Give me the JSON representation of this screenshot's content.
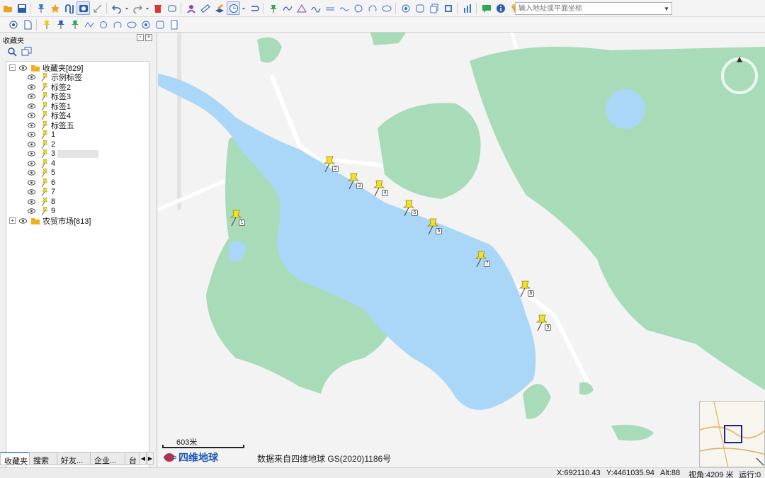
{
  "toolbar": {
    "search_placeholder": "输入地址或平面坐标"
  },
  "sidebar": {
    "title": "收藏夹",
    "tree": [
      {
        "label": "收藏夹[829]",
        "type": "folder",
        "level": 0,
        "expanded": true
      },
      {
        "label": "示例标签",
        "type": "pin",
        "level": 1
      },
      {
        "label": "标签2",
        "type": "pin",
        "level": 1
      },
      {
        "label": "标签3",
        "type": "pin",
        "level": 1
      },
      {
        "label": "标签1",
        "type": "pin",
        "level": 1
      },
      {
        "label": "标签4",
        "type": "pin",
        "level": 1
      },
      {
        "label": "标签五",
        "type": "pin",
        "level": 1
      },
      {
        "label": "1",
        "type": "pin",
        "level": 1
      },
      {
        "label": "2",
        "type": "pin",
        "level": 1
      },
      {
        "label": "3",
        "type": "pin",
        "level": 1,
        "highlighted": true
      },
      {
        "label": "4",
        "type": "pin",
        "level": 1
      },
      {
        "label": "5",
        "type": "pin",
        "level": 1
      },
      {
        "label": "6",
        "type": "pin",
        "level": 1
      },
      {
        "label": "7",
        "type": "pin",
        "level": 1
      },
      {
        "label": "8",
        "type": "pin",
        "level": 1
      },
      {
        "label": "9",
        "type": "pin",
        "level": 1
      },
      {
        "label": "农贸市场[813]",
        "type": "folder",
        "level": 0,
        "expanded": false
      }
    ],
    "tabs": [
      "收藏夹",
      "搜索",
      "好友...",
      "企业...",
      "台"
    ]
  },
  "map": {
    "scale_label": "603米",
    "logo_text": "四维地球",
    "copyright": "数据来自四维地球 GS(2020)1186号",
    "pins": [
      "2",
      "3",
      "4",
      "5",
      "6",
      "7",
      "8",
      "9",
      "1"
    ],
    "water_color": "#aad7f7",
    "park_color": "#a8dbb8",
    "pin_color": "#f4e02b"
  },
  "status": {
    "x": "X:692110.43",
    "y": "Y:4461035.94",
    "alt": "Alt:88",
    "view": "视角:4209 米",
    "run": "运行:0"
  }
}
